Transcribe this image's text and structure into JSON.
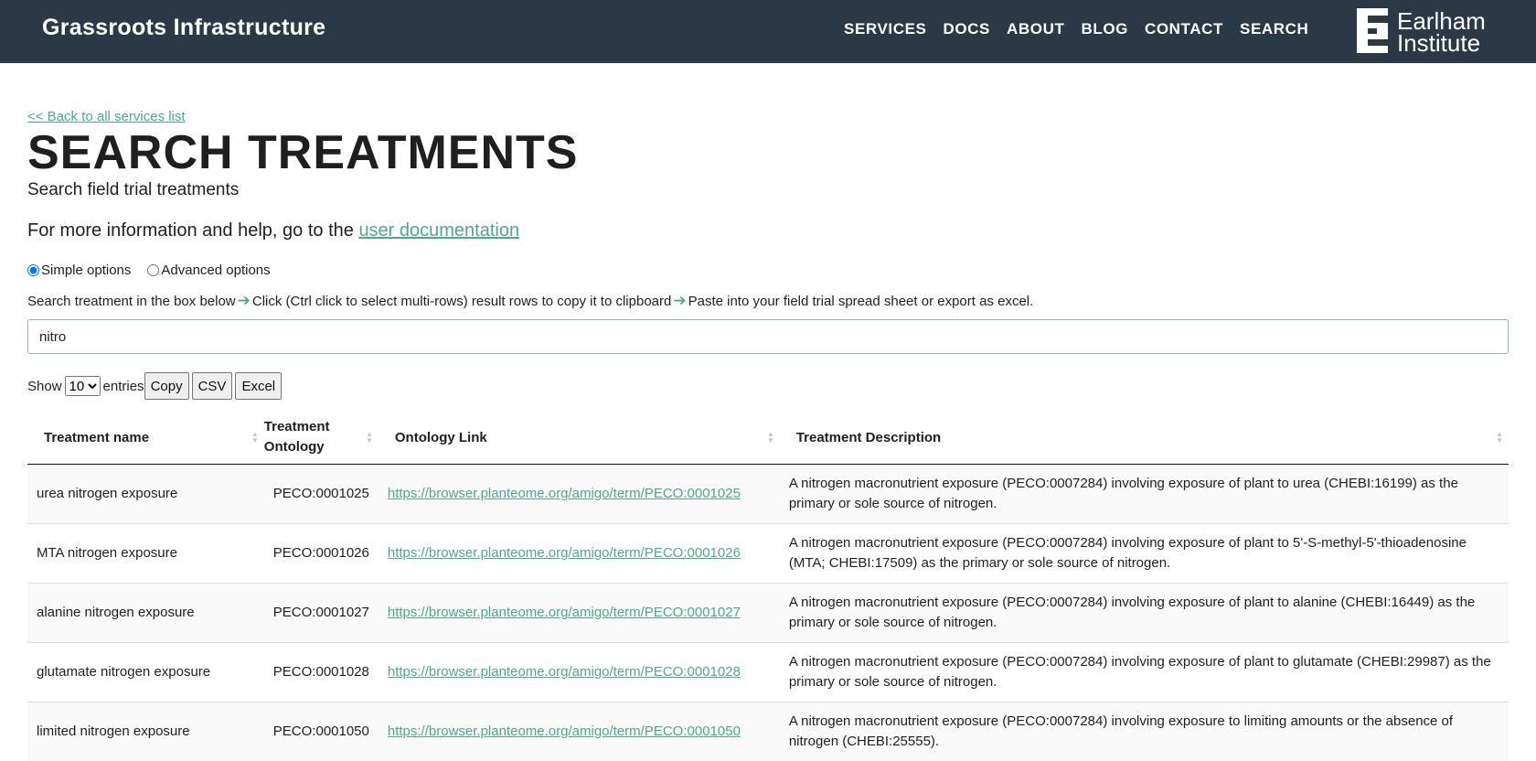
{
  "header": {
    "brand": "Grassroots Infrastructure",
    "nav": [
      "SERVICES",
      "DOCS",
      "ABOUT",
      "BLOG",
      "CONTACT",
      "SEARCH"
    ],
    "logo_line1": "Earlham",
    "logo_line2": "Institute"
  },
  "page": {
    "back_link": "<< Back to all services list",
    "title": "SEARCH TREATMENTS",
    "subtitle": "Search field trial treatments",
    "info_prefix": "For more information and help, go to the",
    "info_link": "user documentation",
    "options": {
      "simple": "Simple options",
      "advanced": "Advanced options",
      "selected": "simple"
    },
    "instructions": {
      "part1": "Search treatment in the box below",
      "part2": "Click (Ctrl click to select multi-rows) result rows to copy it to clipboard",
      "part3": "Paste into your field trial spread sheet or export as excel."
    },
    "search_value": "nitro",
    "show_label": "Show",
    "entries_value": "10",
    "entries_label": "entries",
    "buttons": {
      "copy": "Copy",
      "csv": "CSV",
      "excel": "Excel"
    }
  },
  "table": {
    "headers": [
      "Treatment name",
      "Treatment Ontology",
      "Ontology Link",
      "Treatment Description"
    ],
    "rows": [
      {
        "name": "urea nitrogen exposure",
        "ontology": "PECO:0001025",
        "link": "https://browser.planteome.org/amigo/term/PECO:0001025",
        "description": "A nitrogen macronutrient exposure (PECO:0007284) involving exposure of plant to urea (CHEBI:16199) as the primary or sole source of nitrogen."
      },
      {
        "name": "MTA nitrogen exposure",
        "ontology": "PECO:0001026",
        "link": "https://browser.planteome.org/amigo/term/PECO:0001026",
        "description": "A nitrogen macronutrient exposure (PECO:0007284) involving exposure of plant to 5'-S-methyl-5'-thioadenosine (MTA; CHEBI:17509) as the primary or sole source of nitrogen."
      },
      {
        "name": "alanine nitrogen exposure",
        "ontology": "PECO:0001027",
        "link": "https://browser.planteome.org/amigo/term/PECO:0001027",
        "description": "A nitrogen macronutrient exposure (PECO:0007284) involving exposure of plant to alanine (CHEBI:16449) as the primary or sole source of nitrogen."
      },
      {
        "name": "glutamate nitrogen exposure",
        "ontology": "PECO:0001028",
        "link": "https://browser.planteome.org/amigo/term/PECO:0001028",
        "description": "A nitrogen macronutrient exposure (PECO:0007284) involving exposure of plant to glutamate (CHEBI:29987) as the primary or sole source of nitrogen."
      },
      {
        "name": "limited nitrogen exposure",
        "ontology": "PECO:0001050",
        "link": "https://browser.planteome.org/amigo/term/PECO:0001050",
        "description": "A nitrogen macronutrient exposure (PECO:0007284) involving exposure to limiting amounts or the absence of nitrogen (CHEBI:25555)."
      }
    ]
  },
  "colors": {
    "header_bg": "#2d3846",
    "accent": "#4caa8a"
  }
}
